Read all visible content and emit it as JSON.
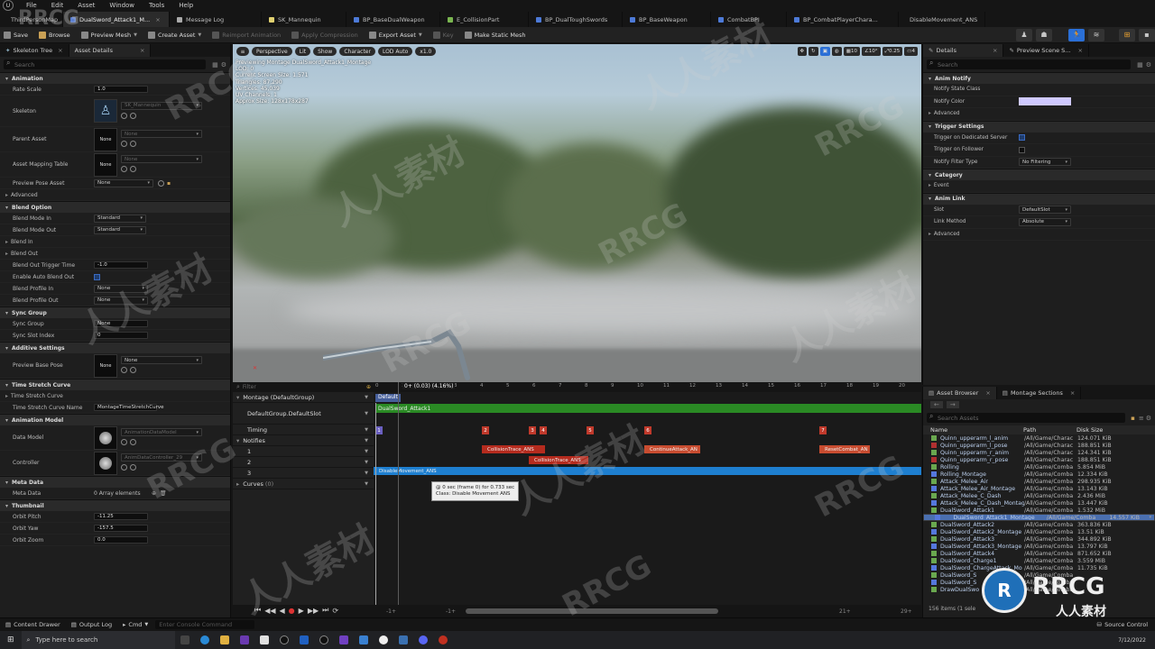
{
  "menu": [
    "File",
    "Edit",
    "Asset",
    "Window",
    "Tools",
    "Help"
  ],
  "tabs": [
    {
      "label": "ThirdPersonMap",
      "color": "#888"
    },
    {
      "label": "DualSword_Attack1_M...",
      "color": "#5b7fd0",
      "active": true
    },
    {
      "label": "Message Log",
      "color": "#aaa"
    },
    {
      "label": "SK_Mannequin",
      "color": "#e0d070"
    },
    {
      "label": "BP_BaseDualWeapon",
      "color": "#4d7ad8"
    },
    {
      "label": "E_CollisionPart",
      "color": "#7ab650"
    },
    {
      "label": "BP_DualToughSwords",
      "color": "#4d7ad8"
    },
    {
      "label": "BP_BaseWeapon",
      "color": "#4d7ad8"
    },
    {
      "label": "CombatBPI",
      "color": "#4d7ad8"
    },
    {
      "label": "BP_CombatPlayerChara...",
      "color": "#4d7ad8"
    },
    {
      "label": "DisableMovement_ANS",
      "color": "#4d7ad8"
    }
  ],
  "toolbar": {
    "save": "Save",
    "browse": "Browse",
    "preview_mesh": "Preview Mesh",
    "create_asset": "Create Asset",
    "reimport": "Reimport Animation",
    "apply_compression": "Apply Compression",
    "export_asset": "Export Asset",
    "key": "Key",
    "make_static_mesh": "Make Static Mesh"
  },
  "left": {
    "tab1": "Skeleton Tree",
    "tab2": "Asset Details",
    "search_placeholder": "Search",
    "sections": {
      "animation": "Animation",
      "blend_option": "Blend Option",
      "sync_group": "Sync Group",
      "additive": "Additive Settings",
      "time_stretch": "Time Stretch Curve",
      "anim_model": "Animation Model",
      "meta": "Meta Data",
      "thumbnail": "Thumbnail"
    },
    "rate_scale": {
      "label": "Rate Scale",
      "value": "1.0"
    },
    "skeleton": {
      "label": "Skeleton",
      "value": "SK_Mannequin"
    },
    "parent_asset": {
      "label": "Parent Asset",
      "thumb": "None",
      "value": "None"
    },
    "asset_mapping": {
      "label": "Asset Mapping Table",
      "thumb": "None",
      "value": "None"
    },
    "preview_pose": {
      "label": "Preview Pose Asset",
      "value": "None"
    },
    "advanced": "Advanced",
    "blend_mode_in": {
      "label": "Blend Mode In",
      "value": "Standard"
    },
    "blend_mode_out": {
      "label": "Blend Mode Out",
      "value": "Standard"
    },
    "blend_in": "Blend In",
    "blend_out": "Blend Out",
    "blend_out_trigger": {
      "label": "Blend Out Trigger Time",
      "value": "-1.0"
    },
    "auto_blend": {
      "label": "Enable Auto Blend Out"
    },
    "blend_profile_in": {
      "label": "Blend Profile In",
      "value": "None"
    },
    "blend_profile_out": {
      "label": "Blend Profile Out",
      "value": "None"
    },
    "sync_group_row": {
      "label": "Sync Group",
      "value": "None"
    },
    "sync_slot": {
      "label": "Sync Slot Index",
      "value": "0"
    },
    "preview_base": {
      "label": "Preview Base Pose",
      "thumb": "None",
      "value": "None"
    },
    "tsc": {
      "label": "Time Stretch Curve"
    },
    "tsc_name": {
      "label": "Time Stretch Curve Name",
      "value": "MontageTimeStretchCurve"
    },
    "data_model": {
      "label": "Data Model",
      "value": "AnimationDataModel"
    },
    "controller": {
      "label": "Controller",
      "value": "AnimDataController_29"
    },
    "meta_row": {
      "label": "Meta Data",
      "value": "0 Array elements"
    },
    "orbit_pitch": {
      "label": "Orbit Pitch",
      "value": "-11.25"
    },
    "orbit_yaw": {
      "label": "Orbit Yaw",
      "value": "-157.5"
    },
    "orbit_zoom": {
      "label": "Orbit Zoom",
      "value": "0.0"
    }
  },
  "viewport": {
    "perspective": "Perspective",
    "lit": "Lit",
    "show": "Show",
    "character": "Character",
    "lod": "LOD Auto",
    "speed": "x1.0",
    "stats": [
      "Previewing Montage DualSword_Attack1_Montage",
      "LOD: 0",
      "Current Screen Size: 1.571",
      "Triangles: 87,290",
      "Vertices: 45,039",
      "UV Channels: 1",
      "Approx Size: 128x178x287"
    ],
    "right_vals": [
      "10",
      "10°",
      "0.25",
      "4"
    ]
  },
  "timeline": {
    "filter_placeholder": "Filter",
    "time_readout": "0+ (0.03) (4.16%)",
    "montage": "Montage (DefaultGroup)",
    "slot": "DefaultGroup.DefaultSlot",
    "timing": "Timing",
    "notifies": "Notifies",
    "tracks": [
      "1",
      "2",
      "3"
    ],
    "curves": "Curves",
    "curves_count": "(0)",
    "section_default": "Default",
    "segment": "DualSword_Attack1",
    "timing_marks": [
      "1",
      "2",
      "3",
      "4",
      "5",
      "6",
      "7"
    ],
    "ticks": [
      "0",
      "1",
      "2",
      "3",
      "4",
      "5",
      "6",
      "7",
      "8",
      "9",
      "10",
      "11",
      "12",
      "13",
      "14",
      "15",
      "16",
      "17",
      "18",
      "19",
      "20",
      "21"
    ],
    "notifies_list": [
      {
        "label": "CollisionTrace_ANS",
        "track": 1,
        "color": "#b52b1e"
      },
      {
        "label": "ContinueAttack_AN",
        "track": 1,
        "color": "#c84c30"
      },
      {
        "label": "ResetCombat_AN",
        "track": 1,
        "color": "#c84c30"
      },
      {
        "label": "CollisionTrace_ANS",
        "track": 2,
        "color": "#b52b1e"
      },
      {
        "label": "DisableMovement_ANS",
        "track": 3,
        "color": "#1e7fd0"
      }
    ],
    "tooltip": [
      "@ 0 sec (frame 0) for 0.733 sec",
      "Class: Disable Movement ANS"
    ],
    "bottom_left": "-1+",
    "bottom_mid": "-1+",
    "bottom_r1": "21+",
    "bottom_r2": "29+"
  },
  "details": {
    "tab1": "Details",
    "tab2": "Preview Scene S...",
    "search_placeholder": "Search",
    "anim_notify": "Anim Notify",
    "notify_state_class": "Notify State Class",
    "notify_color": "Notify Color",
    "notify_color_hex": "#cfc9ff",
    "advanced": "Advanced",
    "trigger_settings": "Trigger Settings",
    "trigger_dedicated": "Trigger on Dedicated Server",
    "trigger_follower": "Trigger on Follower",
    "notify_filter": "Notify Filter Type",
    "notify_filter_value": "No Filtering",
    "category": "Category",
    "event": "Event",
    "anim_link": "Anim Link",
    "slot": "Slot",
    "slot_value": "DefaultSlot",
    "link_method": "Link Method",
    "link_value": "Absolute",
    "advanced2": "Advanced"
  },
  "assets": {
    "tab1": "Asset Browser",
    "tab2": "Montage Sections",
    "search_placeholder": "Search Assets",
    "col_name": "Name",
    "col_path": "Path",
    "col_size": "Disk Size",
    "items": [
      {
        "n": "Quinn_upperarm_l_anim",
        "p": "/All/Game/Charac",
        "s": "124.071 KiB",
        "c": "#6aa84f"
      },
      {
        "n": "Quinn_upperarm_l_pose",
        "p": "/All/Game/Charac",
        "s": "188.851 KiB",
        "c": "#b03030"
      },
      {
        "n": "Quinn_upperarm_r_anim",
        "p": "/All/Game/Charac",
        "s": "124.341 KiB",
        "c": "#6aa84f"
      },
      {
        "n": "Quinn_upperarm_r_pose",
        "p": "/All/Game/Charac",
        "s": "188.851 KiB",
        "c": "#b03030"
      },
      {
        "n": "Rolling",
        "p": "/All/Game/Comba",
        "s": "5.854 MiB",
        "c": "#6aa84f"
      },
      {
        "n": "Rolling_Montage",
        "p": "/All/Game/Comba",
        "s": "12.334 KiB",
        "c": "#5577dd"
      },
      {
        "n": "Attack_Melee_Air",
        "p": "/All/Game/Comba",
        "s": "298.935 KiB",
        "c": "#6aa84f"
      },
      {
        "n": "Attack_Melee_Air_Montage",
        "p": "/All/Game/Comba",
        "s": "13.143 KiB",
        "c": "#5577dd"
      },
      {
        "n": "Attack_Melee_C_Dash",
        "p": "/All/Game/Comba",
        "s": "2.436 MiB",
        "c": "#6aa84f"
      },
      {
        "n": "Attack_Melee_C_Dash_Montage",
        "p": "/All/Game/Comba",
        "s": "13.447 KiB",
        "c": "#5577dd"
      },
      {
        "n": "DualSword_Attack1",
        "p": "/All/Game/Comba",
        "s": "1.532 MiB",
        "c": "#6aa84f"
      },
      {
        "n": "DualSword_Attack1_Montage",
        "p": "/All/Game/Comba",
        "s": "14.557 KiB",
        "c": "#5577dd",
        "sel": true
      },
      {
        "n": "DualSword_Attack2",
        "p": "/All/Game/Comba",
        "s": "363.836 KiB",
        "c": "#6aa84f"
      },
      {
        "n": "DualSword_Attack2_Montage",
        "p": "/All/Game/Comba",
        "s": "13.51 KiB",
        "c": "#5577dd"
      },
      {
        "n": "DualSword_Attack3",
        "p": "/All/Game/Comba",
        "s": "344.892 KiB",
        "c": "#6aa84f"
      },
      {
        "n": "DualSword_Attack3_Montage",
        "p": "/All/Game/Comba",
        "s": "13.797 KiB",
        "c": "#5577dd"
      },
      {
        "n": "DualSword_Attack4",
        "p": "/All/Game/Comba",
        "s": "871.652 KiB",
        "c": "#6aa84f"
      },
      {
        "n": "DualSword_Charge1",
        "p": "/All/Game/Comba",
        "s": "3.559 MiB",
        "c": "#6aa84f"
      },
      {
        "n": "DualSword_ChargeAttack_Mo",
        "p": "/All/Game/Comba",
        "s": "11.735 KiB",
        "c": "#5577dd"
      },
      {
        "n": "DualSword_S",
        "p": "/All/Game/Comba",
        "s": "",
        "c": "#6aa84f"
      },
      {
        "n": "DualSword_S",
        "p": "/All/Game/Comba",
        "s": "",
        "c": "#5577dd"
      },
      {
        "n": "DrawDualSwo",
        "p": "/All/Game/Comba",
        "s": "",
        "c": "#6aa84f"
      }
    ],
    "count": "156 items (1 sele"
  },
  "status": {
    "content_drawer": "Content Drawer",
    "output_log": "Output Log",
    "cmd": "Cmd",
    "console_placeholder": "Enter Console Command",
    "source_control": "Source Control"
  },
  "taskbar": {
    "search": "Type here to search",
    "date": "7/12/2022"
  },
  "watermarks": [
    "RRCG",
    "人人素材"
  ]
}
